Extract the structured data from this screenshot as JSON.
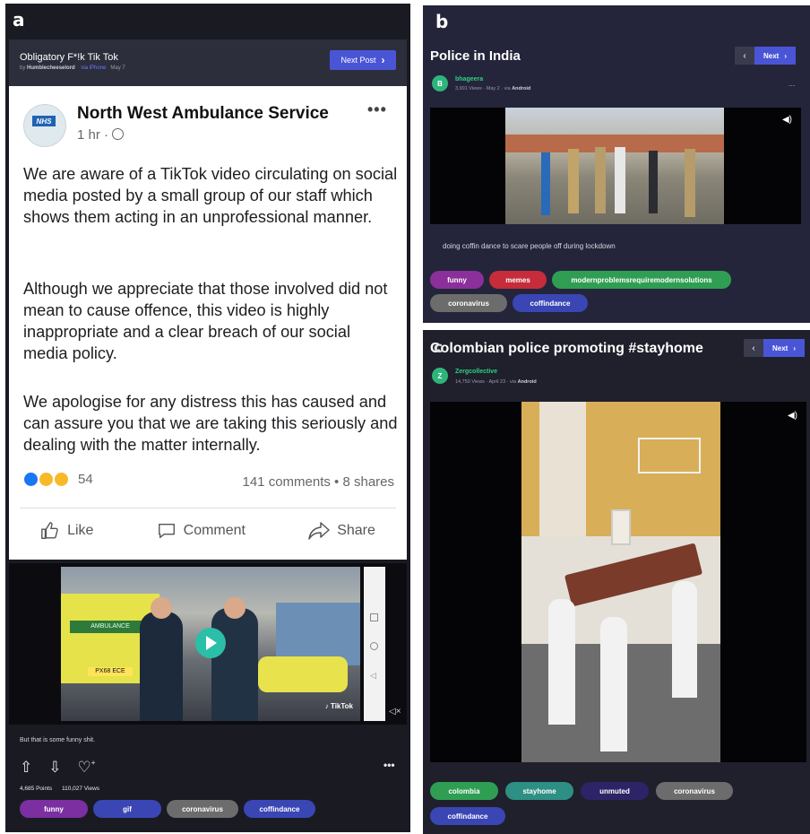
{
  "panel_labels": {
    "a": "a",
    "b": "b",
    "c": "c"
  },
  "panel_a": {
    "post_title": "Obligatory F*!k Tik Tok",
    "by_prefix": "by",
    "author": "Humblecheeselord",
    "via": "via iPhone",
    "date": "May 7",
    "next_label": "Next Post",
    "next_icon": "chevron-right-icon",
    "facebook": {
      "org_name": "North West Ambulance Service",
      "logo_text": "NHS",
      "time": "1 hr",
      "paragraph1": "We are aware of a TikTok video circulating on social media posted by a small group of our staff which shows them acting in an unprofessional manner.",
      "paragraph2": "Although we appreciate that those involved did not mean to cause offence, this video is highly inappropriate and a clear breach of our social media policy.",
      "paragraph3": "We apologise for any distress this has caused and can assure you that we are taking this seriously and dealing with the matter internally.",
      "reaction_count": "54",
      "comments_shares": "141 comments • 8 shares",
      "like": "Like",
      "comment": "Comment",
      "share": "Share"
    },
    "video": {
      "watermark": "TikTok",
      "ambulance_text": "AMBULANCE",
      "plate": "PX68 ECE"
    },
    "caption": "But that is some funny shit.",
    "points": "4,685 Points",
    "views": "110,027 Views",
    "tags": [
      {
        "label": "funny",
        "color": "#7b2fa0"
      },
      {
        "label": "gif",
        "color": "#3a46b4"
      },
      {
        "label": "coronavirus",
        "color": "#6c6c6c"
      },
      {
        "label": "coffindance",
        "color": "#3a46b4"
      }
    ]
  },
  "panel_b": {
    "title": "Police in India",
    "next_label": "Next",
    "user": "bhageera",
    "user_initial": "B",
    "meta_prefix": "3,901 Views · May 2 · via",
    "meta_platform": "Android",
    "more": "...",
    "caption": "doing coffin dance to scare people off during lockdown",
    "tags": [
      {
        "label": "funny",
        "color": "#8b2f9a"
      },
      {
        "label": "memes",
        "color": "#c62c3a"
      },
      {
        "label": "modernproblemsrequiremodernsolutions",
        "color": "#2f9e52"
      },
      {
        "label": "coronavirus",
        "color": "#6c6c6c"
      },
      {
        "label": "coffindance",
        "color": "#3a46b4"
      }
    ]
  },
  "panel_c": {
    "title": "Colombian police promoting #stayhome",
    "next_label": "Next",
    "user": "Zergcollective",
    "user_initial": "Z",
    "meta_prefix": "14,750 Views · April 23 · via",
    "meta_platform": "Android",
    "tags": [
      {
        "label": "colombia",
        "color": "#2f9e52"
      },
      {
        "label": "stayhome",
        "color": "#2e8f84"
      },
      {
        "label": "unmuted",
        "color": "#2c2466"
      },
      {
        "label": "coronavirus",
        "color": "#6c6c6c"
      },
      {
        "label": "coffindance",
        "color": "#3a46b4"
      }
    ]
  }
}
